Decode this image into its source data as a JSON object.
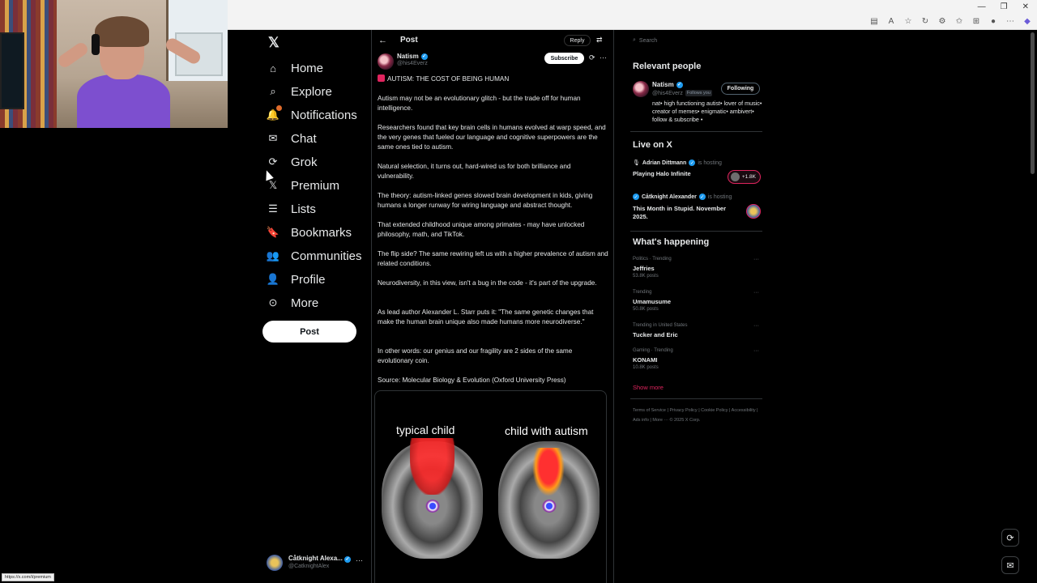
{
  "nav": {
    "items": [
      {
        "label": "Home",
        "icon": "home-icon"
      },
      {
        "label": "Explore",
        "icon": "search-icon"
      },
      {
        "label": "Notifications",
        "icon": "bell-icon"
      },
      {
        "label": "Chat",
        "icon": "mail-icon"
      },
      {
        "label": "Grok",
        "icon": "grok-icon"
      },
      {
        "label": "Premium",
        "icon": "x-logo-icon"
      },
      {
        "label": "Lists",
        "icon": "list-icon"
      },
      {
        "label": "Bookmarks",
        "icon": "bookmark-icon"
      },
      {
        "label": "Communities",
        "icon": "people-icon"
      },
      {
        "label": "Profile",
        "icon": "person-icon"
      },
      {
        "label": "More",
        "icon": "more-circle-icon"
      }
    ],
    "post_label": "Post",
    "account": {
      "name": "Cåtknight Alexa...",
      "handle": "@CatknightAlex"
    }
  },
  "header": {
    "title": "Post",
    "reply_label": "Reply"
  },
  "post": {
    "author": "Natism",
    "handle": "@his4Everz",
    "subscribe_label": "Subscribe",
    "paragraphs": [
      "AUTISM: THE COST OF BEING HUMAN",
      "Autism may not be an evolutionary glitch - but the trade off for human intelligence.",
      "Researchers found that key brain cells in humans evolved at warp speed, and the very genes that fueled our language and cognitive superpowers are the same ones tied to autism.",
      "Natural selection, it turns out, hard-wired us for both brilliance and vulnerability.",
      "The theory: autism-linked genes slowed brain development in kids, giving humans a longer runway for wiring language and abstract thought.",
      "That extended childhood  unique among primates - may have unlocked philosophy, math, and TikTok.",
      "The flip side? The same rewiring left us with a higher prevalence of autism and related conditions.",
      "Neurodiversity, in this view, isn't a bug in the code - it's part of the upgrade.",
      "As lead author Alexander L. Starr puts it: \"The same genetic changes that make the human brain unique also made humans more neurodiverse.\"",
      "In other words: our genius and our fragility are 2 sides of the same evolutionary coin.",
      "Source: Molecular Biology & Evolution (Oxford University Press)"
    ],
    "image_labels": {
      "left": "typical child",
      "right": "child with autism"
    }
  },
  "right": {
    "search_placeholder": "Search",
    "relevant_title": "Relevant people",
    "person": {
      "name": "Natism",
      "handle": "@his4Everz",
      "follows_you": "Follows you",
      "following_label": "Following",
      "bio": "nat• high functioning autist• lover of music• creator of memes• enigmatic• ambivert• follow & subscribe •"
    },
    "live_title": "Live on X",
    "live": [
      {
        "host": "Adrian Dittmann",
        "status": "is hosting",
        "title": "Playing Halo Infinite",
        "badge": "+1.8K"
      },
      {
        "host": "Cåtknight Alexander",
        "status": "is hosting",
        "title": "This Month in Stupid. November 2025."
      }
    ],
    "happening_title": "What's happening",
    "trends": [
      {
        "context": "Politics · Trending",
        "name": "Jeffries",
        "count": "53.8K posts"
      },
      {
        "context": "Trending",
        "name": "Umamusume",
        "count": "50.8K posts"
      },
      {
        "context": "Trending in United States",
        "name": "Tucker and Eric",
        "count": ""
      },
      {
        "context": "Gaming · Trending",
        "name": "KONAMI",
        "count": "10.8K posts"
      }
    ],
    "show_more": "Show more",
    "footer": "Terms of Service  |  Privacy Policy  |  Cookie Policy  |  Accessibility  |  Ads info  |  More ···  © 2025 X Corp."
  },
  "status_url": "https://x.com/i/premium",
  "colors": {
    "background": "#000000",
    "text": "#e7e9ea",
    "muted": "#71767b",
    "accent": "#1d9bf0",
    "live": "#e0245e"
  }
}
